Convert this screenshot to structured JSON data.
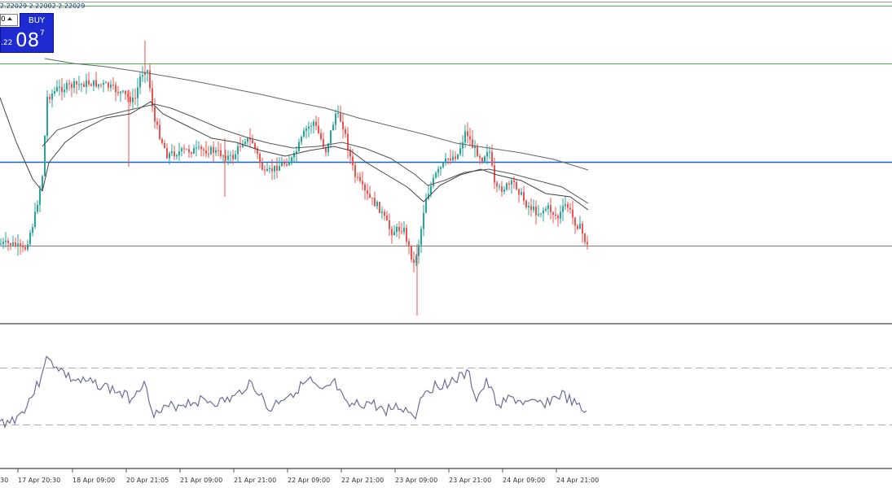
{
  "header": {
    "ohlc_text": "2.22029 2.22002 2.22029"
  },
  "trade_panel": {
    "buy_label": "BUY",
    "lot_value": "0",
    "price_prefix": ".22",
    "price_big": "08",
    "price_sup": "7"
  },
  "time_axis": [
    "30",
    "17 Apr 20:30",
    "18 Apr 09:00",
    "20 Apr 21:05",
    "21 Apr 09:00",
    "21 Apr 21:00",
    "22 Apr 09:00",
    "22 Apr 21:00",
    "23 Apr 09:00",
    "23 Apr 21:00",
    "24 Apr 09:00",
    "24 Apr 21:00"
  ],
  "colors": {
    "bull": "#26a69a",
    "bear": "#ef5350",
    "ma": "#555555",
    "hline_green": "#4caf50",
    "hline_blue": "#1565c0",
    "hline_grey": "#7a7a7a",
    "oscillator": "#6b6e96"
  }
}
